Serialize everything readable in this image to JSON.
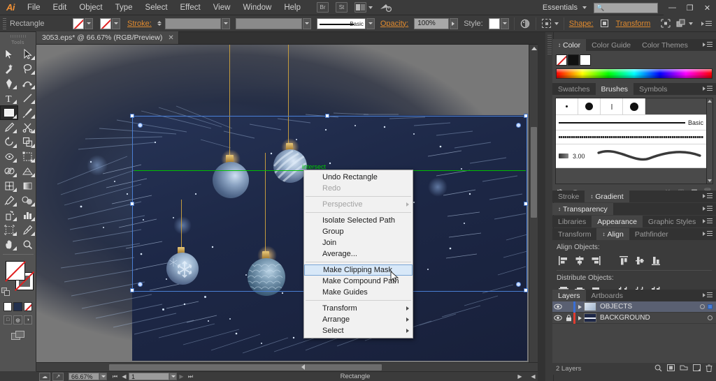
{
  "app": {
    "logo": "Ai",
    "menus": [
      "File",
      "Edit",
      "Object",
      "Type",
      "Select",
      "Effect",
      "View",
      "Window",
      "Help"
    ],
    "workspace": "Essentials",
    "search_placeholder": "",
    "window_buttons": {
      "minimize": "—",
      "restore": "❐",
      "close": "✕"
    },
    "icons": {
      "bridge": "Br",
      "stock": "St",
      "arrange": "arrange-documents-icon",
      "workspace_switch": "workspace-icon"
    }
  },
  "control_bar": {
    "tool_name": "Rectangle",
    "fill_label": "fill-swatch",
    "stroke_swatch_label": "stroke-swatch",
    "stroke_label": "Stroke:",
    "stroke_weight_value": "",
    "stroke_profile_value": "",
    "brush_label": "Basic",
    "opacity_label": "Opacity:",
    "opacity_value": "100%",
    "style_label": "Style:",
    "shape_label": "Shape:",
    "transform_label": "Transform",
    "recolor_icon": "recolor-artwork-icon",
    "align_icon": "align-icon",
    "isolate_icon": "isolate-selection-icon",
    "arrange_icon": "arrange-icon"
  },
  "document": {
    "tab_title": "3053.eps* @ 66.67% (RGB/Preview)",
    "close_glyph": "✕"
  },
  "toolbar": {
    "title": "Tools",
    "selected_tool": "rectangle-tool",
    "tools": [
      "selection-tool",
      "direct-selection-tool",
      "magic-wand-tool",
      "lasso-tool",
      "pen-tool",
      "curvature-tool",
      "type-tool",
      "line-segment-tool",
      "rectangle-tool",
      "paintbrush-tool",
      "pencil-tool",
      "scissors-tool",
      "rotate-tool",
      "scale-tool",
      "width-tool",
      "free-transform-tool",
      "shape-builder-tool",
      "perspective-grid-tool",
      "mesh-tool",
      "gradient-tool",
      "eyedropper-tool",
      "blend-tool",
      "symbol-sprayer-tool",
      "column-graph-tool",
      "artboard-tool",
      "slice-tool",
      "hand-tool",
      "zoom-tool"
    ],
    "fill_stroke": {
      "fill": "none-fill",
      "stroke": "none-stroke"
    },
    "quick_colors": [
      "white",
      "dark-blue",
      "none"
    ],
    "draw_modes": [
      "draw-normal",
      "draw-behind",
      "draw-inside"
    ],
    "screen_mode": "screen-mode-icon"
  },
  "canvas": {
    "guide_label": "intersect",
    "artwork_alt": "christmas-ornaments-on-blue-fir-branches"
  },
  "context_menu": {
    "items": [
      {
        "label": "Undo Rectangle",
        "disabled": false,
        "submenu": false,
        "highlighted": false
      },
      {
        "label": "Redo",
        "disabled": true,
        "submenu": false,
        "highlighted": false
      },
      {
        "separator": true
      },
      {
        "label": "Perspective",
        "disabled": true,
        "submenu": true,
        "highlighted": false
      },
      {
        "separator": true
      },
      {
        "label": "Isolate Selected Path",
        "disabled": false,
        "submenu": false,
        "highlighted": false
      },
      {
        "label": "Group",
        "disabled": false,
        "submenu": false,
        "highlighted": false
      },
      {
        "label": "Join",
        "disabled": false,
        "submenu": false,
        "highlighted": false
      },
      {
        "label": "Average...",
        "disabled": false,
        "submenu": false,
        "highlighted": false
      },
      {
        "separator": true
      },
      {
        "label": "Make Clipping Mask",
        "disabled": false,
        "submenu": false,
        "highlighted": true
      },
      {
        "label": "Make Compound Path",
        "disabled": false,
        "submenu": false,
        "highlighted": false
      },
      {
        "label": "Make Guides",
        "disabled": false,
        "submenu": false,
        "highlighted": false
      },
      {
        "separator": true
      },
      {
        "label": "Transform",
        "disabled": false,
        "submenu": true,
        "highlighted": false
      },
      {
        "label": "Arrange",
        "disabled": false,
        "submenu": true,
        "highlighted": false
      },
      {
        "label": "Select",
        "disabled": false,
        "submenu": true,
        "highlighted": false
      }
    ]
  },
  "panels": {
    "color": {
      "tabs": [
        "Color",
        "Color Guide",
        "Color Themes"
      ],
      "active": "Color",
      "swatches": [
        "none",
        "black",
        "white"
      ]
    },
    "brushes": {
      "tabs": [
        "Swatches",
        "Brushes",
        "Symbols"
      ],
      "active": "Brushes",
      "basic_label": "Basic",
      "size_value": "3.00"
    },
    "gradient": {
      "tabs": [
        "Stroke",
        "Gradient"
      ],
      "active": "Gradient"
    },
    "transparency": {
      "tabs": [
        "Transparency"
      ],
      "active": "Transparency"
    },
    "appearance": {
      "tabs": [
        "Libraries",
        "Appearance",
        "Graphic Styles"
      ],
      "active": "Appearance"
    },
    "align": {
      "tabs": [
        "Transform",
        "Align",
        "Pathfinder"
      ],
      "active": "Align",
      "align_objects_label": "Align Objects:",
      "distribute_objects_label": "Distribute Objects:",
      "align_buttons": [
        "align-left",
        "align-horizontal-center",
        "align-right",
        "align-top",
        "align-vertical-center",
        "align-bottom"
      ],
      "distribute_buttons": [
        "distribute-top",
        "distribute-vertical-center",
        "distribute-bottom",
        "distribute-left",
        "distribute-horizontal-center",
        "distribute-right"
      ]
    },
    "layers": {
      "tabs": [
        "Layers",
        "Artboards"
      ],
      "active": "Layers",
      "rows": [
        {
          "name": "OBJECTS",
          "selected": true,
          "locked": false,
          "color": "#3b6fd4",
          "visible": true
        },
        {
          "name": "BACKGROUND",
          "selected": false,
          "locked": true,
          "color": "#e03c31",
          "visible": true
        }
      ],
      "count_label": "2 Layers",
      "footer_icons": [
        "locate-object-icon",
        "make-mask-icon",
        "new-sublayer-icon",
        "new-layer-icon",
        "delete-layer-icon"
      ]
    }
  },
  "status_bar": {
    "zoom_value": "66.67%",
    "page_value": "1",
    "status_text": "Rectangle",
    "icons": [
      "cloud-sync-icon",
      "share-icon"
    ]
  },
  "colors": {
    "accent_orange": "#e08a2e",
    "panel_bg": "#3b3b3b",
    "panel_body": "#454545",
    "menu_bg": "#3b3b3b",
    "canvas_bg": "#787878",
    "selection_blue": "#4a7fd4",
    "guide_green": "#00c000",
    "highlight_menu": "#d8e8f8"
  }
}
